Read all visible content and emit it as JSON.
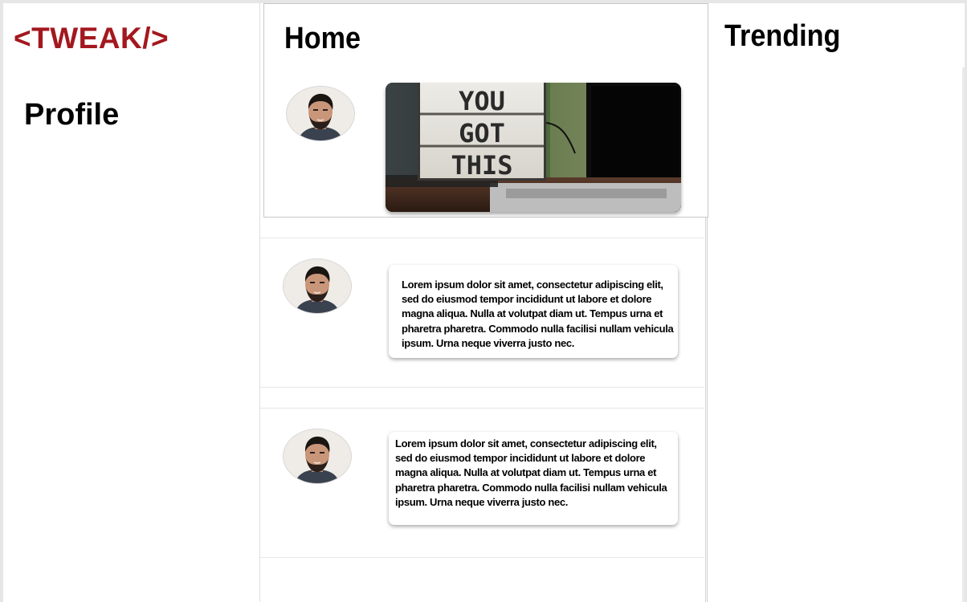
{
  "brand": {
    "logo_text": "<TWEAK/>",
    "color": "#a3181e"
  },
  "sidebar": {
    "profile_label": "Profile"
  },
  "feed": {
    "title": "Home",
    "posts": [
      {
        "type": "image",
        "image_caption_lines": [
          "YOU",
          "GOT",
          "THIS"
        ]
      },
      {
        "type": "text",
        "text": "Lorem ipsum dolor sit amet, consectetur adipiscing elit, sed do eiusmod tempor incididunt ut labore et dolore magna aliqua. Nulla at volutpat diam ut. Tempus urna et pharetra pharetra. Commodo nulla facilisi nullam vehicula ipsum. Urna neque viverra justo nec."
      },
      {
        "type": "text",
        "text": "Lorem ipsum dolor sit amet, consectetur adipiscing elit, sed do eiusmod tempor incididunt ut labore et dolore magna aliqua. Nulla at volutpat diam ut. Tempus urna et pharetra pharetra. Commodo nulla facilisi nullam vehicula ipsum. Urna neque viverra justo nec."
      }
    ]
  },
  "trending": {
    "title": "Trending"
  }
}
